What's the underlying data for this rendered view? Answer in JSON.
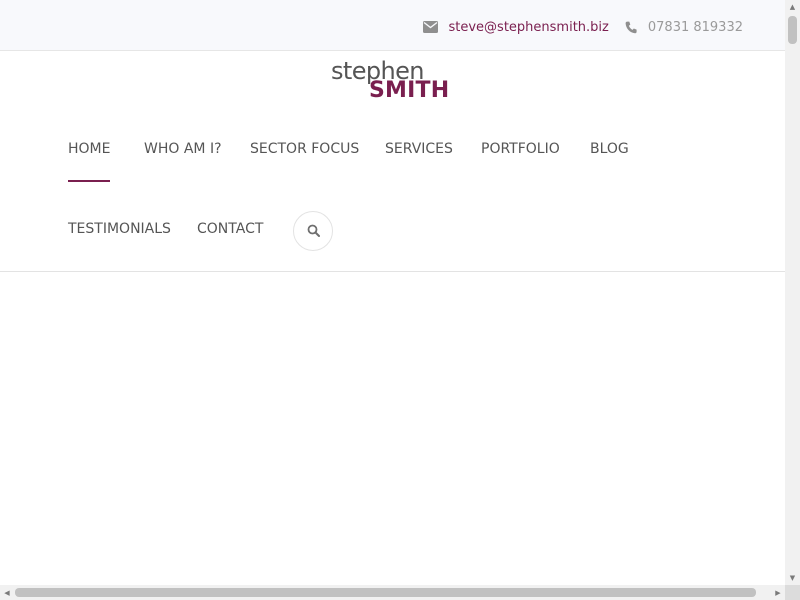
{
  "topbar": {
    "email": "steve@stephensmith.biz",
    "phone": "07831 819332",
    "email_icon": "envelope-icon",
    "phone_icon": "phone-icon"
  },
  "logo": {
    "line1": "stephen",
    "line2": "SMITH"
  },
  "nav": {
    "items": [
      {
        "label": "HOME",
        "active": true
      },
      {
        "label": "WHO AM I?"
      },
      {
        "label": "SECTOR FOCUS"
      },
      {
        "label": "SERVICES"
      },
      {
        "label": "PORTFOLIO"
      },
      {
        "label": "BLOG"
      },
      {
        "label": "TESTIMONIALS"
      },
      {
        "label": "CONTACT"
      }
    ],
    "search_icon": "search-icon"
  },
  "colors": {
    "accent": "#7a1f4f",
    "text": "#555555",
    "muted": "#9a9a9a",
    "topbar_bg": "#f8f9fc"
  }
}
